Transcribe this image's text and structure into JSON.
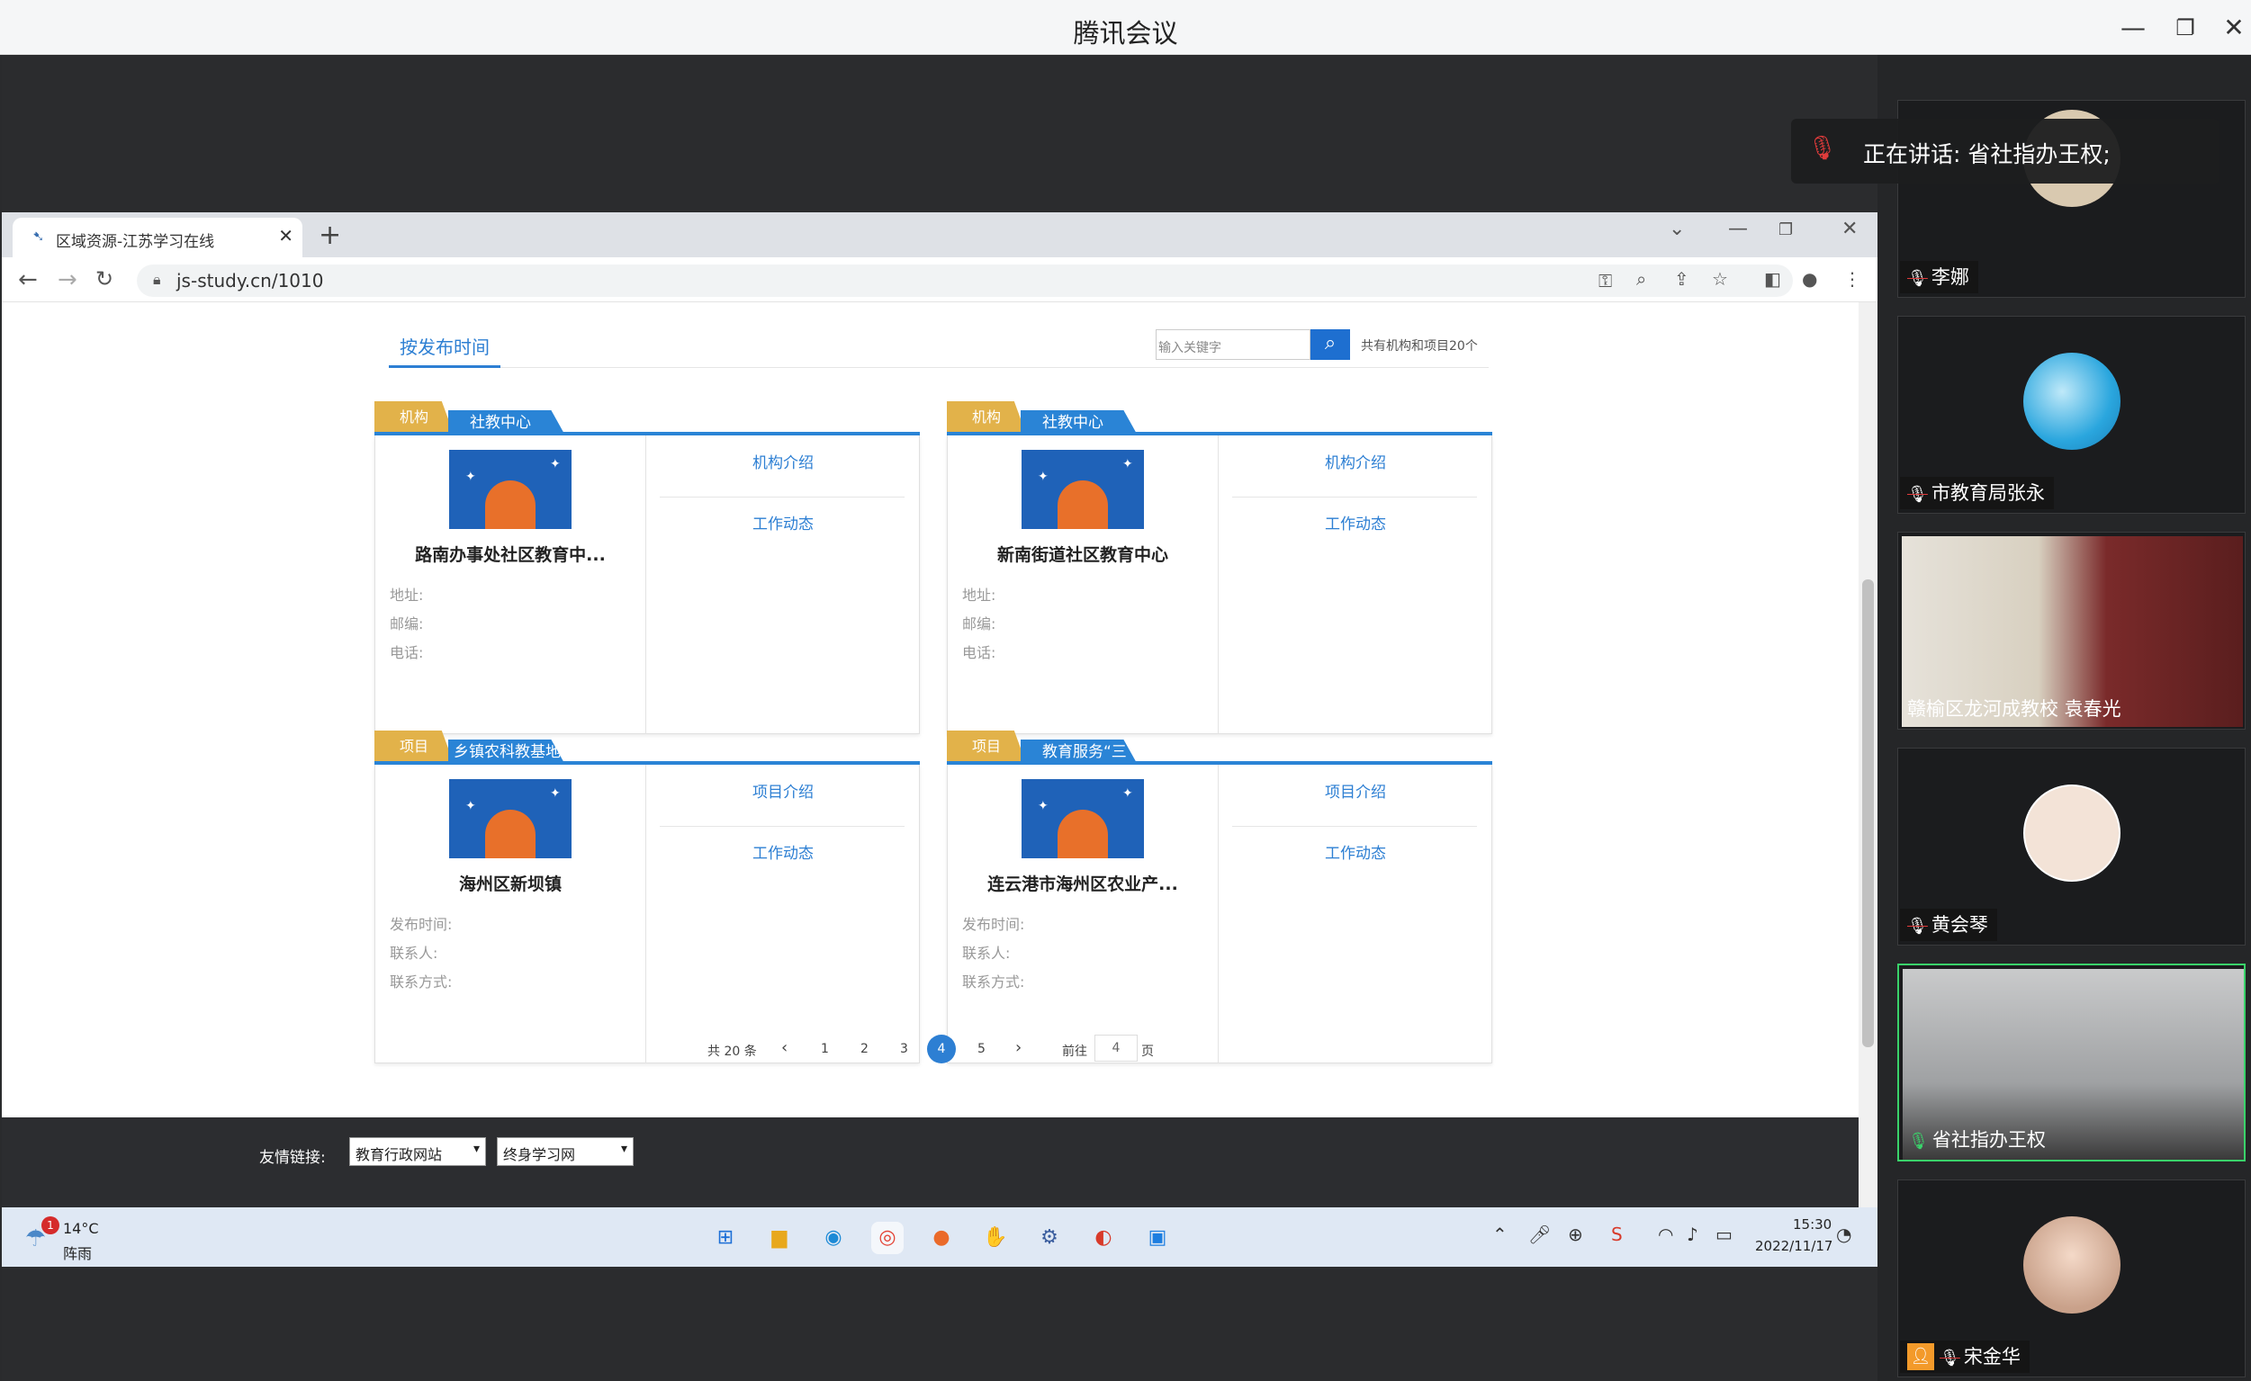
{
  "app": {
    "title": "腾讯会议"
  },
  "browser": {
    "tab_title": "区域资源-江苏学习在线",
    "url": "js-study.cn/1010"
  },
  "page": {
    "filter_tab": "按发布时间",
    "search_placeholder": "输入关键字",
    "total_count": "共有机构和项目20个",
    "cards": [
      {
        "tag": "机构",
        "category": "社教中心",
        "name": "路南办事处社区教育中...",
        "fields": [
          "地址:",
          "邮编:",
          "电话:"
        ],
        "links": [
          "机构介绍",
          "工作动态"
        ]
      },
      {
        "tag": "机构",
        "category": "社教中心",
        "name": "新南街道社区教育中心",
        "fields": [
          "地址:",
          "邮编:",
          "电话:"
        ],
        "links": [
          "机构介绍",
          "工作动态"
        ]
      },
      {
        "tag": "项目",
        "category": "乡镇农科教基地",
        "name": "海州区新坝镇",
        "fields": [
          "发布时间:",
          "联系人:",
          "联系方式:"
        ],
        "links": [
          "项目介绍",
          "工作动态"
        ]
      },
      {
        "tag": "项目",
        "category": "教育服务“三",
        "name": "连云港市海州区农业产...",
        "fields": [
          "发布时间:",
          "联系人:",
          "联系方式:"
        ],
        "links": [
          "项目介绍",
          "工作动态"
        ]
      }
    ],
    "pagination": {
      "total": "共 20 条",
      "prev": "‹",
      "next": "›",
      "pages": [
        "1",
        "2",
        "3",
        "4",
        "5"
      ],
      "active": "4",
      "goto_label": "前往",
      "goto_value": "4",
      "page_suffix": "页"
    },
    "footer": {
      "label": "友情链接:",
      "select1": "教育行政网站",
      "select2": "终身学习网"
    }
  },
  "taskbar": {
    "weather_temp": "14°C",
    "weather_desc": "阵雨",
    "weather_badge": "1",
    "time": "15:30",
    "date": "2022/11/17"
  },
  "meeting": {
    "speaking": "正在讲话: 省社指办王权;",
    "participants": [
      {
        "name": "李娜",
        "mic": "off",
        "kind": "avatar",
        "color": "#d9c9b0"
      },
      {
        "name": "市教育局张永",
        "mic": "off",
        "kind": "avatar",
        "color": "#2aa6de"
      },
      {
        "name": "赣榆区龙河成教校 袁春光",
        "mic": "none",
        "kind": "video",
        "color": "#8b6a52"
      },
      {
        "name": "黄会琴",
        "mic": "off",
        "kind": "avatar",
        "color": "#f3e3d7"
      },
      {
        "name": "省社指办王权",
        "mic": "on",
        "kind": "video",
        "color": "#b7b9bb"
      },
      {
        "name": "宋金华",
        "mic": "off",
        "kind": "avatar",
        "color": "#c9a18a"
      }
    ]
  }
}
